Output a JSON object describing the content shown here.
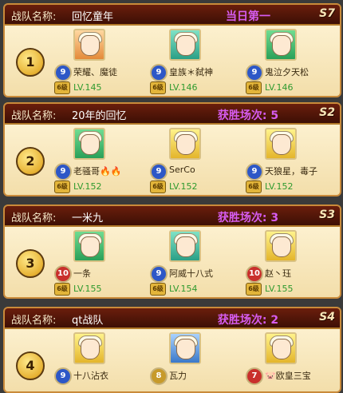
{
  "cards": [
    {
      "label": "战队名称:",
      "team": "回忆童年",
      "status": "当日第一",
      "badge": "S7",
      "rank": "1",
      "players": [
        {
          "name": "荣耀、魔徒",
          "level": "LV.145",
          "rank_num": "9",
          "gold": "6级",
          "avatar": "orange"
        },
        {
          "name": "皇族＊弑神",
          "level": "LV.146",
          "rank_num": "9",
          "gold": "6级",
          "avatar": "teal"
        },
        {
          "name": "鬼泣夕天松",
          "level": "LV.146",
          "rank_num": "9",
          "gold": "6级",
          "avatar": "green"
        }
      ]
    },
    {
      "label": "战队名称:",
      "team": "20年的回忆",
      "status": "获胜场次: 5",
      "badge": "S2",
      "rank": "2",
      "players": [
        {
          "name": "老骚哥🔥🔥",
          "level": "LV.152",
          "rank_num": "9",
          "gold": "6级",
          "avatar": "green"
        },
        {
          "name": "SerCo",
          "level": "LV.152",
          "rank_num": "9",
          "gold": "6级",
          "avatar": "yellow"
        },
        {
          "name": "天狼星，毒子",
          "level": "LV.152",
          "rank_num": "9",
          "gold": "6级",
          "avatar": "yellow"
        }
      ]
    },
    {
      "label": "战队名称:",
      "team": "一米九",
      "status": "获胜场次: 3",
      "badge": "S3",
      "rank": "3",
      "players": [
        {
          "name": "一条",
          "level": "LV.155",
          "rank_num": "10",
          "gold": "6级",
          "avatar": "green"
        },
        {
          "name": "阿威十八式",
          "level": "LV.154",
          "rank_num": "9",
          "gold": "6级",
          "avatar": "teal"
        },
        {
          "name": "赵丶珏",
          "level": "LV.155",
          "rank_num": "10",
          "gold": "6级",
          "avatar": "yellow"
        }
      ]
    },
    {
      "label": "战队名称:",
      "team": "qt战队",
      "status": "获胜场次: 2",
      "badge": "S4",
      "rank": "4",
      "players": [
        {
          "name": "十八沾衣",
          "level": "",
          "rank_num": "9",
          "gold": "",
          "avatar": "yellow"
        },
        {
          "name": "瓦力",
          "level": "",
          "rank_num": "8",
          "gold": "",
          "avatar": "blue"
        },
        {
          "name": "🐷欧皇三宝",
          "level": "",
          "rank_num": "7",
          "gold": "",
          "avatar": "yellow"
        }
      ]
    }
  ]
}
